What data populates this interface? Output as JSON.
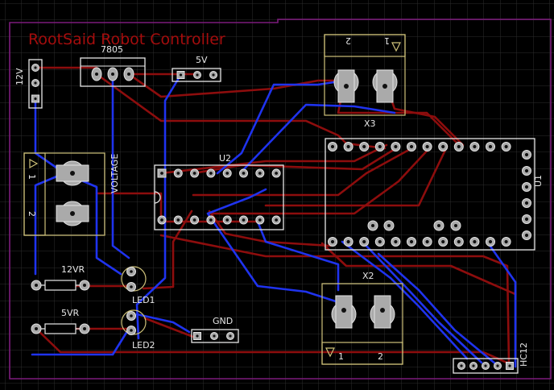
{
  "board": {
    "title": "RootSaid Robot Controller"
  },
  "labels": {
    "j12v": "12V",
    "reg": "7805",
    "j5v": "5V",
    "x3": "X3",
    "x3_pin2": "2",
    "x3_pin1": "1",
    "voltage": "VOLTAGE",
    "vin_pin1": "1",
    "vin_pin2": "2",
    "u2": "U2",
    "u1": "U1",
    "r12": "12VR",
    "r5": "5VR",
    "led1": "LED1",
    "led2": "LED2",
    "gnd": "GND",
    "x2": "X2",
    "x2_pin1": "1",
    "x2_pin2": "2",
    "hc12": "HC12"
  },
  "colors": {
    "background": "#000000",
    "grid": "#2d2d2d",
    "board_outline": "#7c1b7c",
    "top_trace": "#8d0d0d",
    "bottom_trace": "#1f33ee",
    "silkscreen": "#cfc27a",
    "pad": "#aaaaaa",
    "title": "#a40d0d"
  }
}
